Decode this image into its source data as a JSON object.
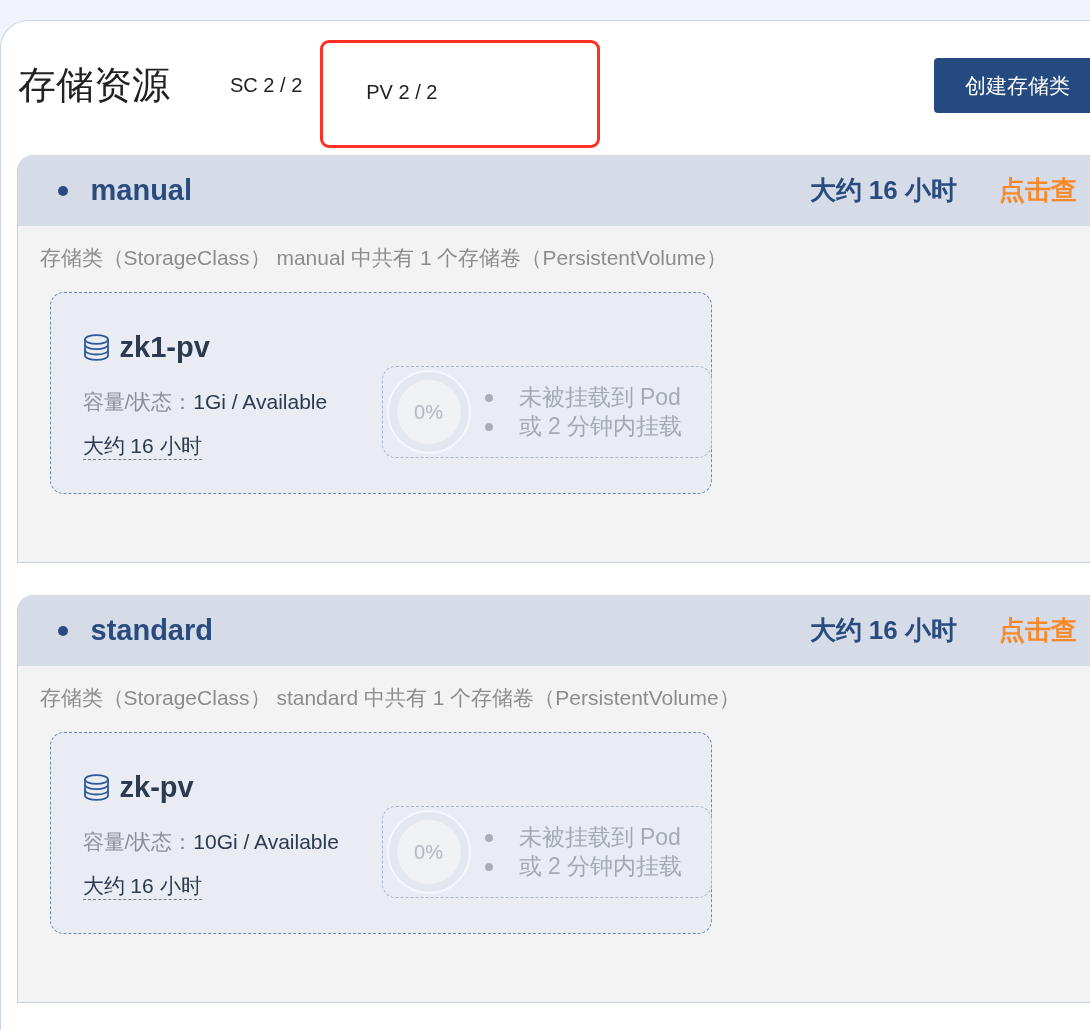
{
  "title": "存储资源",
  "counters": [
    {
      "text": "SC 2 / 2",
      "highlighted": false
    },
    {
      "text": "PV 2 / 2",
      "highlighted": true
    }
  ],
  "create_button": {
    "label": "创建存储类"
  },
  "storage_classes": [
    {
      "name": "manual",
      "age": "大约 16 小时",
      "link": "点击查",
      "description": "存储类（StorageClass） manual 中共有 1 个存储卷（PersistentVolume）",
      "volumes": [
        {
          "name": "zk1-pv",
          "capacity_label": "容量/状态：",
          "capacity_value": "1Gi / Available",
          "age": "大约 16 小时",
          "usage": {
            "percent": "0%",
            "level": 0,
            "notes": [
              "未被挂载到 Pod",
              "或 2 分钟内挂载"
            ]
          }
        }
      ]
    },
    {
      "name": "standard",
      "age": "大约 16 小时",
      "link": "点击查",
      "description": "存储类（StorageClass） standard 中共有 1 个存储卷（PersistentVolume）",
      "volumes": [
        {
          "name": "zk-pv",
          "capacity_label": "容量/状态：",
          "capacity_value": "10Gi / Available",
          "age": "大约 16 小时",
          "usage": {
            "percent": "0%",
            "level": 0,
            "notes": [
              "未被挂载到 Pod",
              "或 2 分钟内挂载"
            ]
          }
        }
      ]
    }
  ]
}
